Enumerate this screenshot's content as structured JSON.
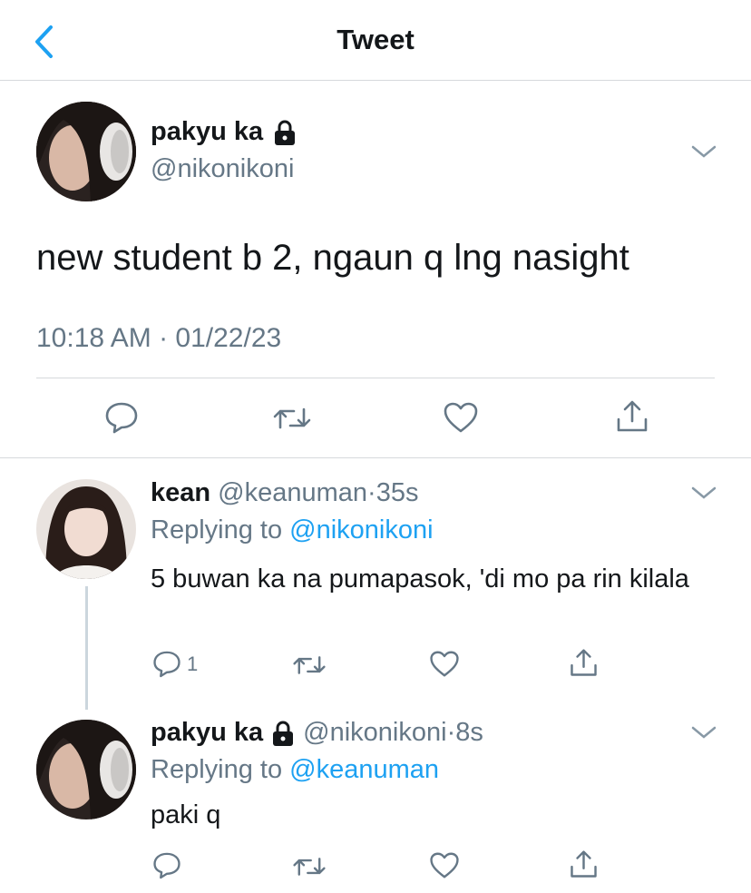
{
  "header": {
    "title": "Tweet"
  },
  "main_tweet": {
    "display_name": "pakyu ka",
    "handle": "@nikonikoni",
    "text": "new student b 2, ngaun q lng nasight",
    "timestamp": "10:18 AM · 01/22/23",
    "actions": [
      "reply",
      "retweet",
      "like",
      "share"
    ]
  },
  "replies": [
    {
      "display_name": "kean",
      "handle": "@keanuman",
      "time": "35s",
      "replying_prefix": "Replying to",
      "replying_to": "@nikonikoni",
      "text": "5 buwan ka na pumapasok, 'di mo pa rin kilala",
      "reply_count": "1"
    },
    {
      "display_name": "pakyu ka",
      "handle": "@nikonikoni",
      "time": "8s",
      "replying_prefix": "Replying to",
      "replying_to": "@keanuman",
      "text": "paki q",
      "reply_count": ""
    }
  ],
  "colors": {
    "accent": "#1da1f2",
    "secondary_text": "#657786",
    "divider": "#d6d9dc"
  }
}
